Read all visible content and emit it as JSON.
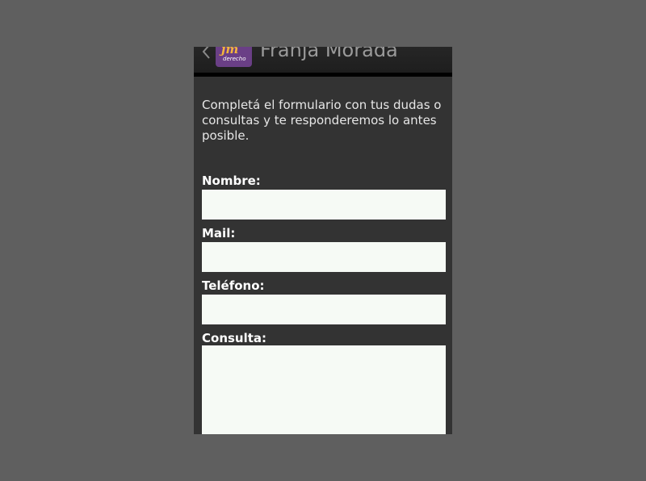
{
  "actionbar": {
    "title": "Franja Morada",
    "logo_mark": "jm",
    "logo_sub": "derecho",
    "back_icon": "chevron-left-icon"
  },
  "intro": {
    "text": "Completá el formulario con tus dudas o consultas y te responderemos lo antes posible."
  },
  "form": {
    "name_label": "Nombre:",
    "name_value": "",
    "mail_label": "Mail:",
    "mail_value": "",
    "phone_label": "Teléfono:",
    "phone_value": "",
    "query_label": "Consulta:",
    "query_value": ""
  },
  "colors": {
    "background": "#5f5f5f",
    "screen": "#333333",
    "actionbar": "#222222",
    "logo_bg": "#6a3f86",
    "logo_accent": "#f4b63c",
    "input_bg": "#f6faf5"
  }
}
